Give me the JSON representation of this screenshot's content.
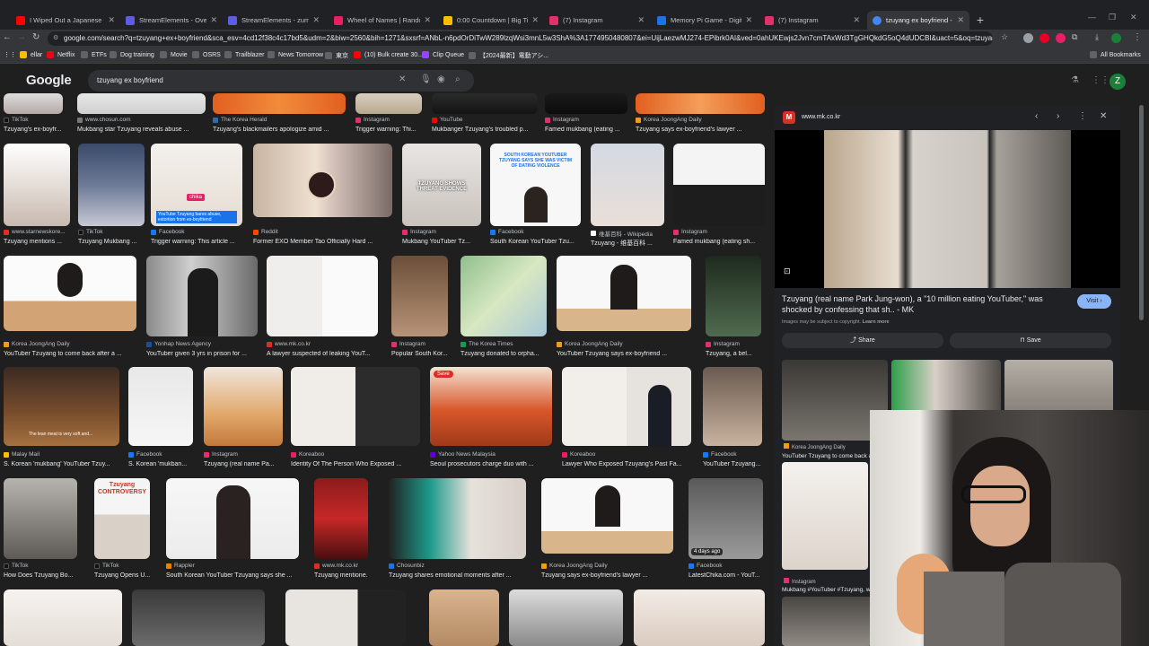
{
  "browser": {
    "tabs": [
      {
        "title": "I Wiped Out a Japanese Conve",
        "color": "#ff0000"
      },
      {
        "title": "StreamElements - Overlays",
        "color": "#5e5ce6"
      },
      {
        "title": "StreamElements - zumi",
        "color": "#5e5ce6"
      },
      {
        "title": "Wheel of Names | Random na",
        "color": "#e91e63"
      },
      {
        "title": "0:00 Countdown | Big Timer -",
        "color": "#fbbc04"
      },
      {
        "title": "(7) Instagram",
        "color": "#e1306c"
      },
      {
        "title": "Memory Pi Game - Digits of pi",
        "color": "#1a73e8"
      },
      {
        "title": "(7) Instagram",
        "color": "#e1306c"
      },
      {
        "title": "tzuyang ex boyfriend - Google",
        "color": "#4285f4"
      }
    ],
    "url": "google.com/search?q=tzuyang+ex+boyfriend&sca_esv=4cd12f38c4c17bd5&udm=2&biw=2560&bih=1271&sxsrf=ANbL-n6pdOrDiTwW289lzqWsi3mnL5w3ShA%3A1774950480807&ei=UijLaezwMJ274-EPibrk0AI&ved=0ahUKEwjs2Jvn7cmTAxWd3TgGHQkdG5oQ4dUDCBI&uact=5&oq=tzuyang+ex+boyfriend&gs_lp=Egtnd3Mtd2l6LW...",
    "bookmarks": [
      {
        "label": "ellar",
        "color": "#fbbc04"
      },
      {
        "label": "Netflix",
        "color": "#e50914"
      },
      {
        "label": "ETFs",
        "color": "#5f6368"
      },
      {
        "label": "Dog training",
        "color": "#5f6368"
      },
      {
        "label": "Movie",
        "color": "#5f6368"
      },
      {
        "label": "OSRS",
        "color": "#5f6368"
      },
      {
        "label": "Trailblazer",
        "color": "#5f6368"
      },
      {
        "label": "News Tomorrow",
        "color": "#5f6368"
      },
      {
        "label": "東京",
        "color": "#5f6368"
      },
      {
        "label": "(10) Bulk create 30...",
        "color": "#ff0000"
      },
      {
        "label": "Clip Queue",
        "color": "#9146ff"
      },
      {
        "label": "【2024最新】電動アシ...",
        "color": "#5f6368"
      }
    ],
    "all_bookmarks": "All Bookmarks"
  },
  "google": {
    "logo": "Google",
    "query": "tzuyang ex boyfriend",
    "avatar_letter": "Z"
  },
  "results": {
    "row0": [
      {
        "src": "TikTok",
        "cap": "Tzuyang's ex-boyfr..."
      },
      {
        "src": "www.chosun.com",
        "cap": "Mukbang star Tzuyang reveals abuse ..."
      },
      {
        "src": "The Korea Herald",
        "cap": "Tzuyang's blackmailers apologize amid ..."
      },
      {
        "src": "Instagram",
        "cap": "Trigger warning: Thi..."
      },
      {
        "src": "YouTube",
        "cap": "Mukbanger Tzuyang's troubled p..."
      },
      {
        "src": "Instagram",
        "cap": "Famed mukbang (eating ..."
      },
      {
        "src": "Korea JoongAng Daily",
        "cap": "Tzuyang says ex-boyfriend's lawyer ..."
      }
    ],
    "row1": [
      {
        "src": "www.starnewskore...",
        "cap": "Tzuyang mentions ..."
      },
      {
        "src": "TikTok",
        "cap": "Tzuyang Mukbang ..."
      },
      {
        "src": "Facebook",
        "cap": "Trigger warning: This article ..."
      },
      {
        "src": "Reddit",
        "cap": "Former EXO Member Tao Officially Hard ..."
      },
      {
        "src": "Instagram",
        "cap": "Mukbang YouTuber Tz..."
      },
      {
        "src": "Facebook",
        "cap": "South Korean YouTuber Tzu..."
      },
      {
        "src": "维基百科 - Wikipedia",
        "cap": "Tzuyang - 维基百科 ..."
      },
      {
        "src": "Instagram",
        "cap": "Famed mukbang (eating sh..."
      }
    ],
    "row1_overlays": {
      "chika": "chika",
      "bared": "YouTube Tzuyang bares abuse, extortion from ex-boyfriend",
      "threat": "TZUYANG SHOWS THREAT EVIDENCE",
      "headline": "SOUTH KOREAN YOUTUBER TZUYANG SAYS SHE WAS VICTIM OF DATING VIOLENCE"
    },
    "row2": [
      {
        "src": "Korea JoongAng Daily",
        "cap": "YouTuber Tzuyang to come back after a ..."
      },
      {
        "src": "Yonhap News Agency",
        "cap": "YouTuber given 3 yrs in prison for ..."
      },
      {
        "src": "www.mk.co.kr",
        "cap": "A lawyer suspected of leaking YouT..."
      },
      {
        "src": "Instagram",
        "cap": "Popular South Kor..."
      },
      {
        "src": "The Korea Times",
        "cap": "Tzuyang donated to orpha..."
      },
      {
        "src": "Korea JoongAng Daily",
        "cap": "YouTuber Tzuyang says ex-boyfriend ..."
      },
      {
        "src": "Instagram",
        "cap": "Tzuyang, a bel..."
      }
    ],
    "row3": [
      {
        "src": "Malay Mail",
        "cap": "S. Korean 'mukbang' YouTuber Tzuy..."
      },
      {
        "src": "Facebook",
        "cap": "S. Korean 'mukban..."
      },
      {
        "src": "Instagram",
        "cap": "Tzuyang (real name Pa..."
      },
      {
        "src": "Koreaboo",
        "cap": "Identity Of The Person Who Exposed ..."
      },
      {
        "src": "Yahoo News Malaysia",
        "cap": "Seoul prosecutors charge duo with ..."
      },
      {
        "src": "Koreaboo",
        "cap": "Lawyer Who Exposed Tzuyang's Past Fa..."
      },
      {
        "src": "Facebook",
        "cap": "YouTuber Tzuyang..."
      }
    ],
    "row3_overlays": {
      "lean_meat": "The lean meat is very soft and...",
      "save": "Save"
    },
    "row4": [
      {
        "src": "TikTok",
        "cap": "How Does Tzuyang Bo..."
      },
      {
        "src": "TikTok",
        "cap": "Tzuyang Opens U..."
      },
      {
        "src": "Rappler",
        "cap": "South Korean YouTuber Tzuyang says she ..."
      },
      {
        "src": "www.mk.co.kr",
        "cap": "Tzuyang mentione..."
      },
      {
        "src": "Chosunbiz",
        "cap": "Tzuyang shares emotional moments after ..."
      },
      {
        "src": "Korea JoongAng Daily",
        "cap": "Tzuyang says ex-boyfriend's lawyer ..."
      },
      {
        "src": "Facebook",
        "cap": "LatestChika.com - YouT..."
      }
    ],
    "row4_overlays": {
      "controversy": "Tzuyang CONTROVERSY",
      "days": "4 days ago"
    }
  },
  "panel": {
    "domain": "www.mk.co.kr",
    "logo_letter": "M",
    "title": "Tzuyang (real name Park Jung-won), a \"10 million eating YouTuber,\" was shocked by confessing that sh.. - MK",
    "visit": "Visit",
    "copyright": "Images may be subject to copyright.",
    "learn_more": "Learn more",
    "share": "Share",
    "save": "Save",
    "related": [
      {
        "src": "Korea JoongAng Daily",
        "cap": "YouTuber Tzuyang to come back aft..."
      },
      {
        "src": "Instagram",
        "cap": "Mukbang #YouTuber #Tzuyang, who..."
      }
    ]
  }
}
